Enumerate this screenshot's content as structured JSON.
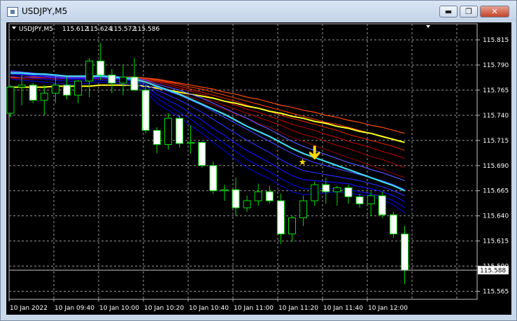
{
  "window": {
    "title": "USDJPY,M5",
    "icon": "chart-window-icon",
    "buttons": [
      {
        "name": "minimize-button",
        "glyph": "▬"
      },
      {
        "name": "maximize-button",
        "glyph": "❐"
      },
      {
        "name": "close-button",
        "glyph": "✕"
      }
    ]
  },
  "chart_data": {
    "type": "candlestick",
    "header": "USDJPY,M5  115.612 115.624 115.572 115.586",
    "symbol": "USDJPY,M5",
    "ohlc_label": {
      "open": "115.612",
      "high": "115.624",
      "low": "115.572",
      "close": "115.586"
    },
    "current_price_label": "115.588",
    "ylim": [
      115.557,
      115.831
    ],
    "y_ticks": [
      "115.815",
      "115.790",
      "115.765",
      "115.740",
      "115.715",
      "115.690",
      "115.665",
      "115.640",
      "115.615",
      "115.590",
      "115.565"
    ],
    "y_tick_values": [
      115.815,
      115.79,
      115.765,
      115.74,
      115.715,
      115.69,
      115.665,
      115.64,
      115.615,
      115.59,
      115.565
    ],
    "x_ticks": [
      "10 Jan 2022",
      "10 Jan 09:40",
      "10 Jan 10:00",
      "10 Jan 10:20",
      "10 Jan 10:40",
      "10 Jan 11:00",
      "10 Jan 11:20",
      "10 Jan 11:40",
      "10 Jan 12:00"
    ],
    "grid": true,
    "background": "#000000",
    "colors": {
      "bull_candle": "#000000",
      "bear_candle": "#ffffff",
      "wick": "#00e000",
      "ma_fast": [
        "#0000c8",
        "#0000e0",
        "#1010ff",
        "#2a2aff",
        "#4040ff",
        "#5555ff"
      ],
      "ma_slow": [
        "#7a0000",
        "#990000",
        "#b30000",
        "#cc2200",
        "#e03a00",
        "#ff4a10"
      ],
      "ma_cyan": "#40d8f0",
      "ma_yellow": "#ffff20",
      "signal": "#ffd700"
    },
    "candles": [
      {
        "o": 115.742,
        "h": 115.77,
        "l": 115.738,
        "c": 115.768
      },
      {
        "o": 115.768,
        "h": 115.78,
        "l": 115.75,
        "c": 115.77
      },
      {
        "o": 115.77,
        "h": 115.772,
        "l": 115.752,
        "c": 115.755
      },
      {
        "o": 115.755,
        "h": 115.77,
        "l": 115.74,
        "c": 115.762
      },
      {
        "o": 115.762,
        "h": 115.78,
        "l": 115.752,
        "c": 115.77
      },
      {
        "o": 115.77,
        "h": 115.778,
        "l": 115.756,
        "c": 115.76
      },
      {
        "o": 115.76,
        "h": 115.775,
        "l": 115.752,
        "c": 115.774
      },
      {
        "o": 115.774,
        "h": 115.797,
        "l": 115.758,
        "c": 115.794
      },
      {
        "o": 115.794,
        "h": 115.812,
        "l": 115.775,
        "c": 115.78
      },
      {
        "o": 115.78,
        "h": 115.786,
        "l": 115.762,
        "c": 115.772
      },
      {
        "o": 115.772,
        "h": 115.79,
        "l": 115.76,
        "c": 115.778
      },
      {
        "o": 115.778,
        "h": 115.797,
        "l": 115.77,
        "c": 115.765
      },
      {
        "o": 115.765,
        "h": 115.77,
        "l": 115.722,
        "c": 115.725
      },
      {
        "o": 115.725,
        "h": 115.728,
        "l": 115.702,
        "c": 115.711
      },
      {
        "o": 115.711,
        "h": 115.742,
        "l": 115.706,
        "c": 115.737
      },
      {
        "o": 115.737,
        "h": 115.74,
        "l": 115.708,
        "c": 115.712
      },
      {
        "o": 115.712,
        "h": 115.73,
        "l": 115.702,
        "c": 115.713
      },
      {
        "o": 115.713,
        "h": 115.714,
        "l": 115.688,
        "c": 115.69
      },
      {
        "o": 115.69,
        "h": 115.694,
        "l": 115.662,
        "c": 115.665
      },
      {
        "o": 115.665,
        "h": 115.671,
        "l": 115.655,
        "c": 115.666
      },
      {
        "o": 115.666,
        "h": 115.678,
        "l": 115.64,
        "c": 115.648
      },
      {
        "o": 115.648,
        "h": 115.66,
        "l": 115.644,
        "c": 115.655
      },
      {
        "o": 115.655,
        "h": 115.672,
        "l": 115.65,
        "c": 115.664
      },
      {
        "o": 115.664,
        "h": 115.67,
        "l": 115.652,
        "c": 115.655
      },
      {
        "o": 115.655,
        "h": 115.662,
        "l": 115.612,
        "c": 115.622
      },
      {
        "o": 115.622,
        "h": 115.64,
        "l": 115.614,
        "c": 115.638
      },
      {
        "o": 115.638,
        "h": 115.66,
        "l": 115.63,
        "c": 115.655
      },
      {
        "o": 115.655,
        "h": 115.674,
        "l": 115.65,
        "c": 115.671
      },
      {
        "o": 115.671,
        "h": 115.678,
        "l": 115.652,
        "c": 115.664
      },
      {
        "o": 115.664,
        "h": 115.67,
        "l": 115.65,
        "c": 115.668
      },
      {
        "o": 115.668,
        "h": 115.671,
        "l": 115.652,
        "c": 115.659
      },
      {
        "o": 115.659,
        "h": 115.662,
        "l": 115.648,
        "c": 115.652
      },
      {
        "o": 115.652,
        "h": 115.664,
        "l": 115.64,
        "c": 115.66
      },
      {
        "o": 115.66,
        "h": 115.664,
        "l": 115.638,
        "c": 115.641
      },
      {
        "o": 115.641,
        "h": 115.644,
        "l": 115.618,
        "c": 115.622
      },
      {
        "o": 115.622,
        "h": 115.63,
        "l": 115.572,
        "c": 115.586
      }
    ],
    "ma_fast_series": [
      [
        115.776,
        115.775,
        115.774,
        115.773,
        115.772,
        115.771,
        115.771,
        115.772,
        115.773,
        115.772,
        115.771,
        115.77,
        115.763,
        115.752,
        115.745,
        115.738,
        115.73,
        115.722,
        115.713,
        115.705,
        115.696,
        115.688,
        115.682,
        115.677,
        115.67,
        115.664,
        115.661,
        115.662,
        115.663,
        115.664,
        115.663,
        115.661,
        115.66,
        115.656,
        115.651,
        115.643
      ],
      [
        115.779,
        115.778,
        115.777,
        115.776,
        115.775,
        115.774,
        115.774,
        115.774,
        115.775,
        115.774,
        115.773,
        115.772,
        115.766,
        115.757,
        115.75,
        115.743,
        115.736,
        115.728,
        115.72,
        115.712,
        115.704,
        115.696,
        115.69,
        115.684,
        115.677,
        115.671,
        115.667,
        115.667,
        115.667,
        115.667,
        115.666,
        115.664,
        115.662,
        115.659,
        115.655,
        115.648
      ],
      [
        115.781,
        115.78,
        115.779,
        115.778,
        115.777,
        115.776,
        115.776,
        115.776,
        115.777,
        115.776,
        115.775,
        115.774,
        115.769,
        115.761,
        115.755,
        115.749,
        115.742,
        115.735,
        115.727,
        115.72,
        115.712,
        115.705,
        115.699,
        115.693,
        115.686,
        115.68,
        115.676,
        115.675,
        115.674,
        115.673,
        115.672,
        115.669,
        115.667,
        115.664,
        115.66,
        115.654
      ],
      [
        115.782,
        115.781,
        115.78,
        115.779,
        115.778,
        115.777,
        115.777,
        115.777,
        115.778,
        115.777,
        115.776,
        115.775,
        115.771,
        115.765,
        115.76,
        115.755,
        115.749,
        115.743,
        115.736,
        115.729,
        115.722,
        115.715,
        115.709,
        115.703,
        115.696,
        115.69,
        115.685,
        115.683,
        115.681,
        115.679,
        115.677,
        115.675,
        115.672,
        115.669,
        115.665,
        115.66
      ],
      [
        115.783,
        115.782,
        115.781,
        115.78,
        115.779,
        115.778,
        115.778,
        115.778,
        115.779,
        115.778,
        115.777,
        115.776,
        115.773,
        115.768,
        115.764,
        115.76,
        115.755,
        115.75,
        115.744,
        115.738,
        115.732,
        115.726,
        115.72,
        115.714,
        115.708,
        115.702,
        115.697,
        115.693,
        115.69,
        115.687,
        115.684,
        115.681,
        115.678,
        115.675,
        115.671,
        115.666
      ],
      [
        115.784,
        115.783,
        115.782,
        115.781,
        115.78,
        115.779,
        115.779,
        115.779,
        115.78,
        115.779,
        115.778,
        115.777,
        115.775,
        115.771,
        115.768,
        115.765,
        115.761,
        115.757,
        115.752,
        115.747,
        115.742,
        115.737,
        115.731,
        115.726,
        115.72,
        115.714,
        115.709,
        115.705,
        115.701,
        115.697,
        115.693,
        115.69,
        115.686,
        115.683,
        115.679,
        115.675
      ]
    ],
    "ma_slow_series": [
      [
        115.776,
        115.776,
        115.776,
        115.776,
        115.776,
        115.776,
        115.776,
        115.776,
        115.776,
        115.776,
        115.775,
        115.775,
        115.773,
        115.769,
        115.766,
        115.762,
        115.758,
        115.754,
        115.75,
        115.746,
        115.741,
        115.737,
        115.732,
        115.728,
        115.723,
        115.718,
        115.714,
        115.71,
        115.706,
        115.702,
        115.698,
        115.694,
        115.69,
        115.686,
        115.682,
        115.678
      ],
      [
        115.777,
        115.777,
        115.777,
        115.777,
        115.777,
        115.777,
        115.777,
        115.777,
        115.777,
        115.777,
        115.776,
        115.776,
        115.774,
        115.771,
        115.768,
        115.765,
        115.761,
        115.757,
        115.754,
        115.75,
        115.746,
        115.742,
        115.738,
        115.734,
        115.73,
        115.725,
        115.721,
        115.718,
        115.714,
        115.71,
        115.707,
        115.703,
        115.699,
        115.696,
        115.692,
        115.688
      ],
      [
        115.778,
        115.778,
        115.778,
        115.778,
        115.778,
        115.778,
        115.778,
        115.778,
        115.778,
        115.778,
        115.777,
        115.777,
        115.775,
        115.773,
        115.77,
        115.767,
        115.764,
        115.761,
        115.757,
        115.754,
        115.75,
        115.746,
        115.743,
        115.739,
        115.735,
        115.731,
        115.728,
        115.725,
        115.721,
        115.718,
        115.714,
        115.711,
        115.708,
        115.704,
        115.701,
        115.697
      ],
      [
        115.778,
        115.778,
        115.778,
        115.778,
        115.778,
        115.778,
        115.778,
        115.778,
        115.778,
        115.778,
        115.778,
        115.778,
        115.776,
        115.774,
        115.772,
        115.769,
        115.766,
        115.763,
        115.76,
        115.757,
        115.754,
        115.75,
        115.747,
        115.744,
        115.74,
        115.737,
        115.734,
        115.731,
        115.728,
        115.725,
        115.721,
        115.718,
        115.715,
        115.712,
        115.709,
        115.705
      ],
      [
        115.778,
        115.778,
        115.778,
        115.778,
        115.778,
        115.778,
        115.778,
        115.778,
        115.778,
        115.778,
        115.778,
        115.778,
        115.777,
        115.775,
        115.773,
        115.771,
        115.768,
        115.766,
        115.763,
        115.76,
        115.757,
        115.754,
        115.751,
        115.748,
        115.745,
        115.742,
        115.739,
        115.736,
        115.733,
        115.731,
        115.728,
        115.725,
        115.722,
        115.719,
        115.716,
        115.713
      ],
      [
        115.778,
        115.778,
        115.778,
        115.778,
        115.778,
        115.778,
        115.778,
        115.778,
        115.778,
        115.778,
        115.778,
        115.778,
        115.777,
        115.776,
        115.774,
        115.772,
        115.77,
        115.768,
        115.766,
        115.763,
        115.761,
        115.758,
        115.756,
        115.753,
        115.75,
        115.748,
        115.745,
        115.743,
        115.74,
        115.738,
        115.735,
        115.733,
        115.73,
        115.728,
        115.725,
        115.722
      ]
    ],
    "ma_cyan_series": [
      115.782,
      115.782,
      115.781,
      115.781,
      115.78,
      115.779,
      115.779,
      115.779,
      115.779,
      115.778,
      115.777,
      115.776,
      115.773,
      115.769,
      115.765,
      115.761,
      115.756,
      115.751,
      115.746,
      115.741,
      115.735,
      115.729,
      115.724,
      115.719,
      115.713,
      115.707,
      115.702,
      115.698,
      115.694,
      115.69,
      115.686,
      115.682,
      115.678,
      115.674,
      115.67,
      115.665
    ],
    "ma_yellow_series": [
      115.768,
      115.768,
      115.768,
      115.768,
      115.769,
      115.769,
      115.769,
      115.769,
      115.77,
      115.77,
      115.77,
      115.77,
      115.769,
      115.767,
      115.765,
      115.763,
      115.761,
      115.759,
      115.757,
      115.754,
      115.752,
      115.749,
      115.747,
      115.744,
      115.742,
      115.739,
      115.737,
      115.734,
      115.732,
      115.729,
      115.727,
      115.724,
      115.722,
      115.719,
      115.716,
      115.713
    ],
    "signals": [
      {
        "type": "star",
        "candle_index": 26,
        "price": 115.694
      },
      {
        "type": "sell-arrow",
        "candle_index": 27,
        "price": 115.7
      }
    ]
  }
}
